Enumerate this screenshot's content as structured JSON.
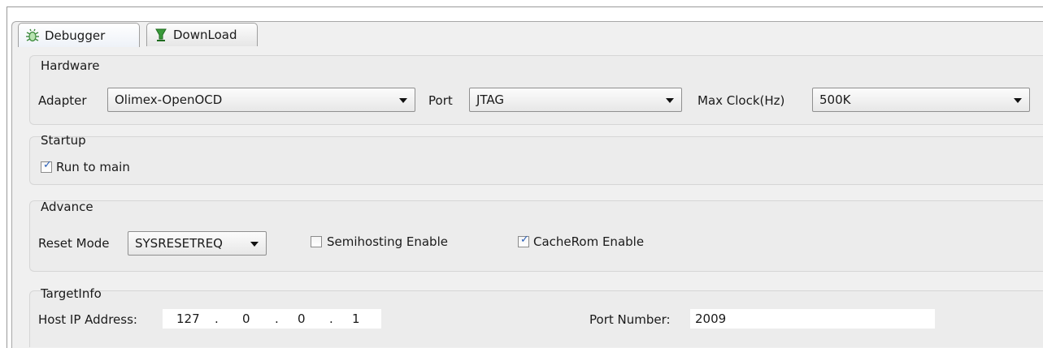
{
  "tabs": [
    {
      "label": "Debugger",
      "icon": "bug-icon",
      "active": true
    },
    {
      "label": "DownLoad",
      "icon": "download-icon",
      "active": false
    }
  ],
  "hardware": {
    "title": "Hardware",
    "adapter_label": "Adapter",
    "adapter_value": "Olimex-OpenOCD",
    "port_label": "Port",
    "port_value": "JTAG",
    "clock_label": "Max Clock(Hz)",
    "clock_value": "500K"
  },
  "startup": {
    "title": "Startup",
    "run_to_main_label": "Run to main",
    "run_to_main_checked": true
  },
  "advance": {
    "title": "Advance",
    "reset_mode_label": "Reset Mode",
    "reset_mode_value": "SYSRESETREQ",
    "semihosting_label": "Semihosting Enable",
    "semihosting_checked": false,
    "cacherom_label": "CacheRom Enable",
    "cacherom_checked": true
  },
  "targetinfo": {
    "title": "TargetInfo",
    "host_ip_label": "Host IP Address:",
    "ip_octets": [
      "127",
      "0",
      "0",
      "1"
    ],
    "ip_separator": ".",
    "port_number_label": "Port Number:",
    "port_number_value": "2009"
  },
  "colors": {
    "check_mark": "#2a5fb7",
    "tab_border": "#9f9f9f",
    "panel_bg": "#f0f0f0"
  }
}
